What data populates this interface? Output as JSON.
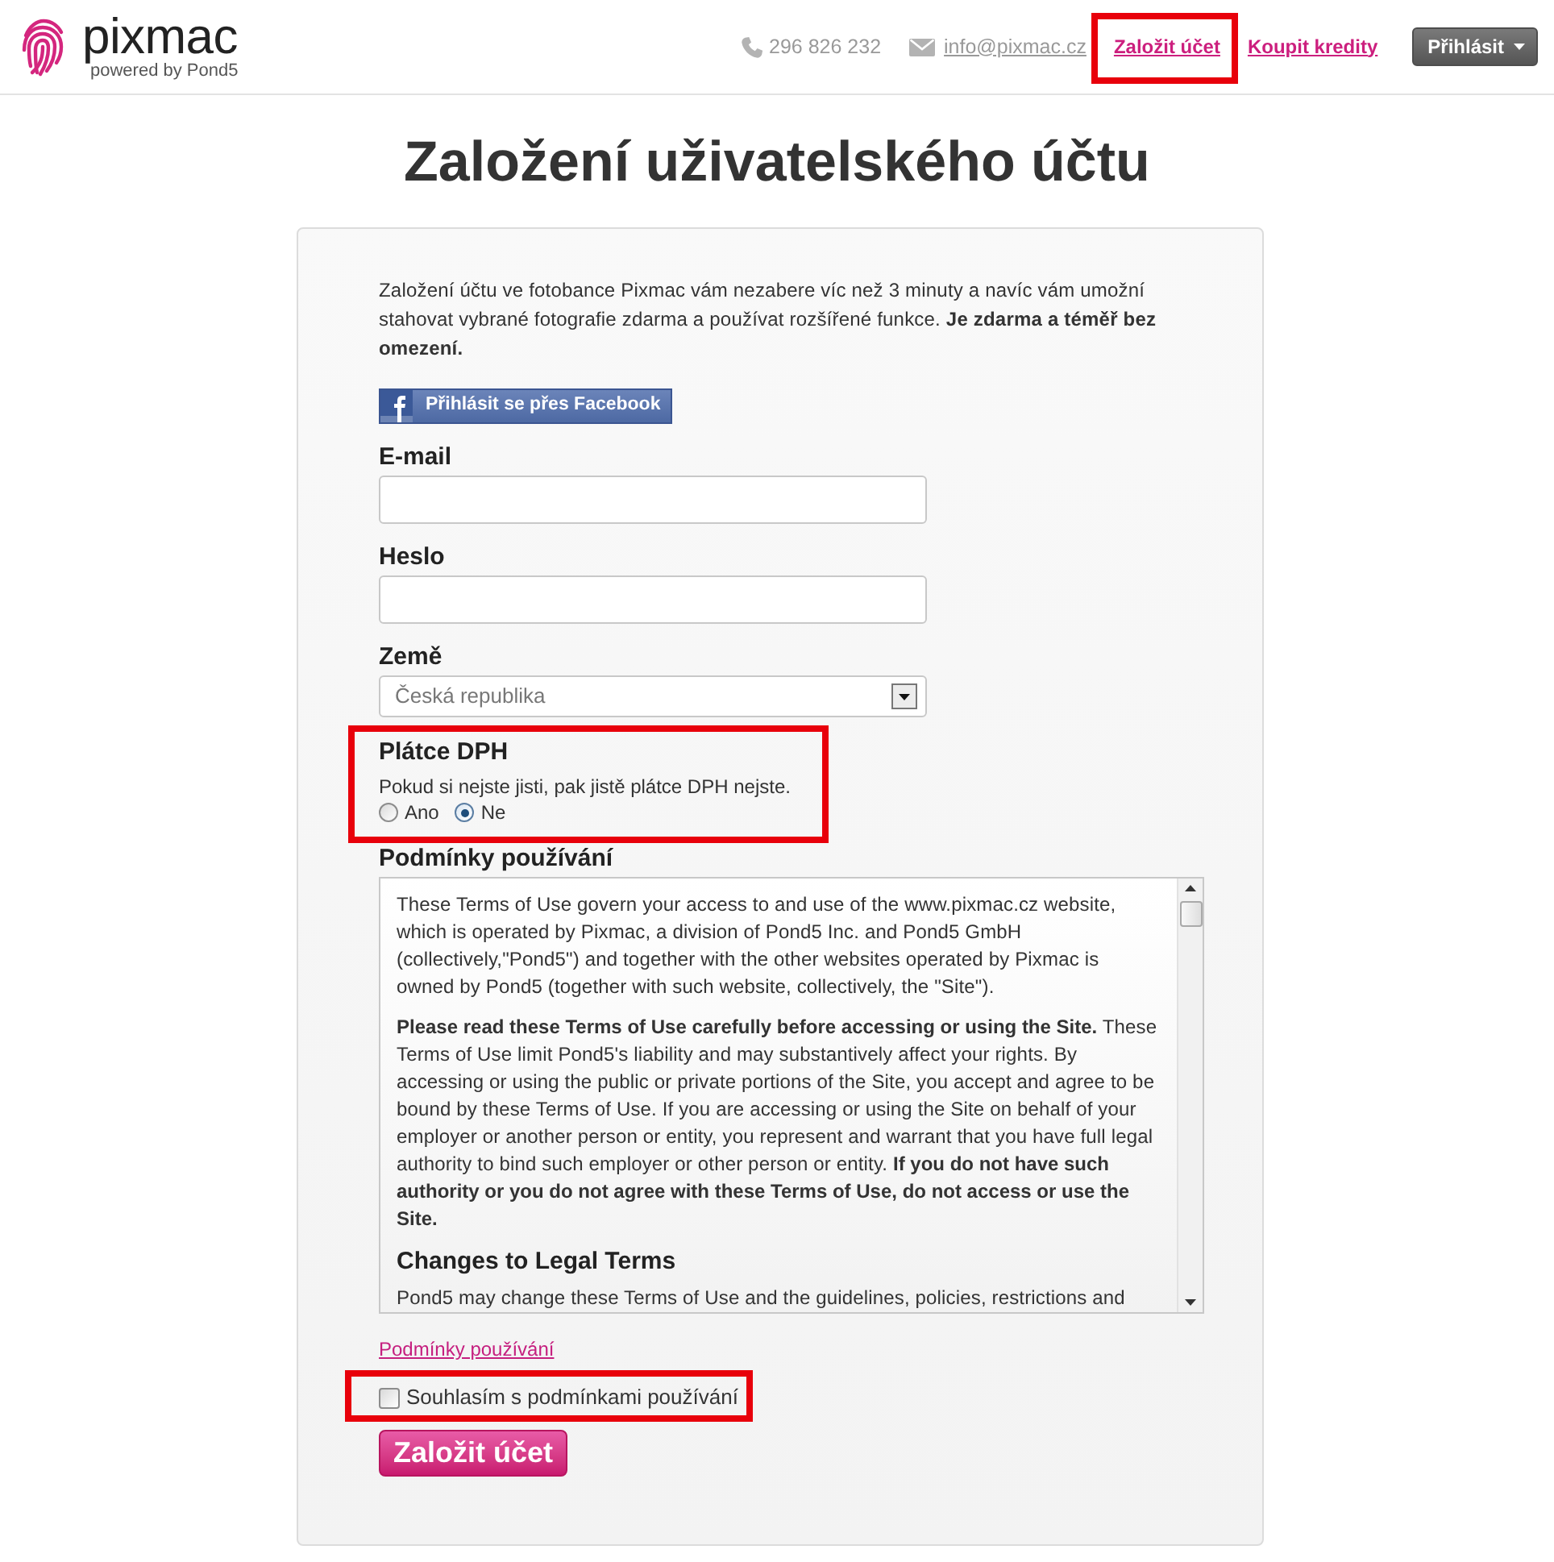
{
  "header": {
    "logo": {
      "name": "pixmac",
      "tagline": "powered by Pond5"
    },
    "phone": "296 826 232",
    "email": "info@pixmac.cz",
    "links": [
      {
        "label": "Založit účet",
        "highlighted": true
      },
      {
        "label": "Koupit kredity",
        "highlighted": false
      }
    ],
    "login_button": "Přihlásit"
  },
  "title": "Založení uživatelského účtu",
  "form": {
    "intro": "Založení účtu ve fotobance Pixmac vám nezabere víc než 3 minuty a navíc vám umožní stahovat vybrané fotografie zdarma a používat rozšířené funkce. **Je zdarma a téměř bez omezení.**",
    "facebook_button": "Přihlásit se přes Facebook",
    "fields": [
      {
        "kind": "email",
        "label": "E-mail"
      },
      {
        "kind": "password",
        "label": "Heslo"
      },
      {
        "kind": "select",
        "label": "Země",
        "value": "Česká republika"
      }
    ],
    "vat": {
      "label": "Plátce DPH",
      "hint": "Pokud si nejste jisti, pak jistě plátce DPH nejste.",
      "options": [
        {
          "label": "Ano",
          "selected": false
        },
        {
          "label": "Ne",
          "selected": true
        }
      ],
      "highlighted": true
    },
    "terms": {
      "label": "Podmínky používání",
      "blocks": [
        {
          "kind": "paragraph",
          "text": "These Terms of Use govern your access to and use of the www.pixmac.cz website, which is operated by Pixmac, a division of Pond5 Inc. and Pond5 GmbH (collectively,\"Pond5\") and together with the other websites operated by Pixmac is owned by Pond5 (together with such website, collectively, the \"Site\")."
        },
        {
          "kind": "paragraph",
          "text": "**Please read these Terms of Use carefully before accessing or using the Site.** These Terms of Use limit Pond5's liability and may substantively affect your rights. By accessing or using the public or private portions of the Site, you accept and agree to be bound by these Terms of Use. If you are accessing or using the Site on behalf of your employer or another person or entity, you represent and warrant that you have full legal authority to bind such employer or other person or entity. **If you do not have such authority or you do not agree with these Terms of Use, do not access or use the Site.**"
        },
        {
          "kind": "heading",
          "text": "Changes to Legal Terms"
        },
        {
          "kind": "paragraph",
          "text": "Pond5 may change these Terms of Use and the guidelines, policies, restrictions and"
        }
      ]
    },
    "terms_link": "Podmínky používání",
    "agree": {
      "label": "Souhlasím s podmínkami používání",
      "checked": false,
      "highlighted": true
    },
    "submit_button": "Založit účet"
  }
}
